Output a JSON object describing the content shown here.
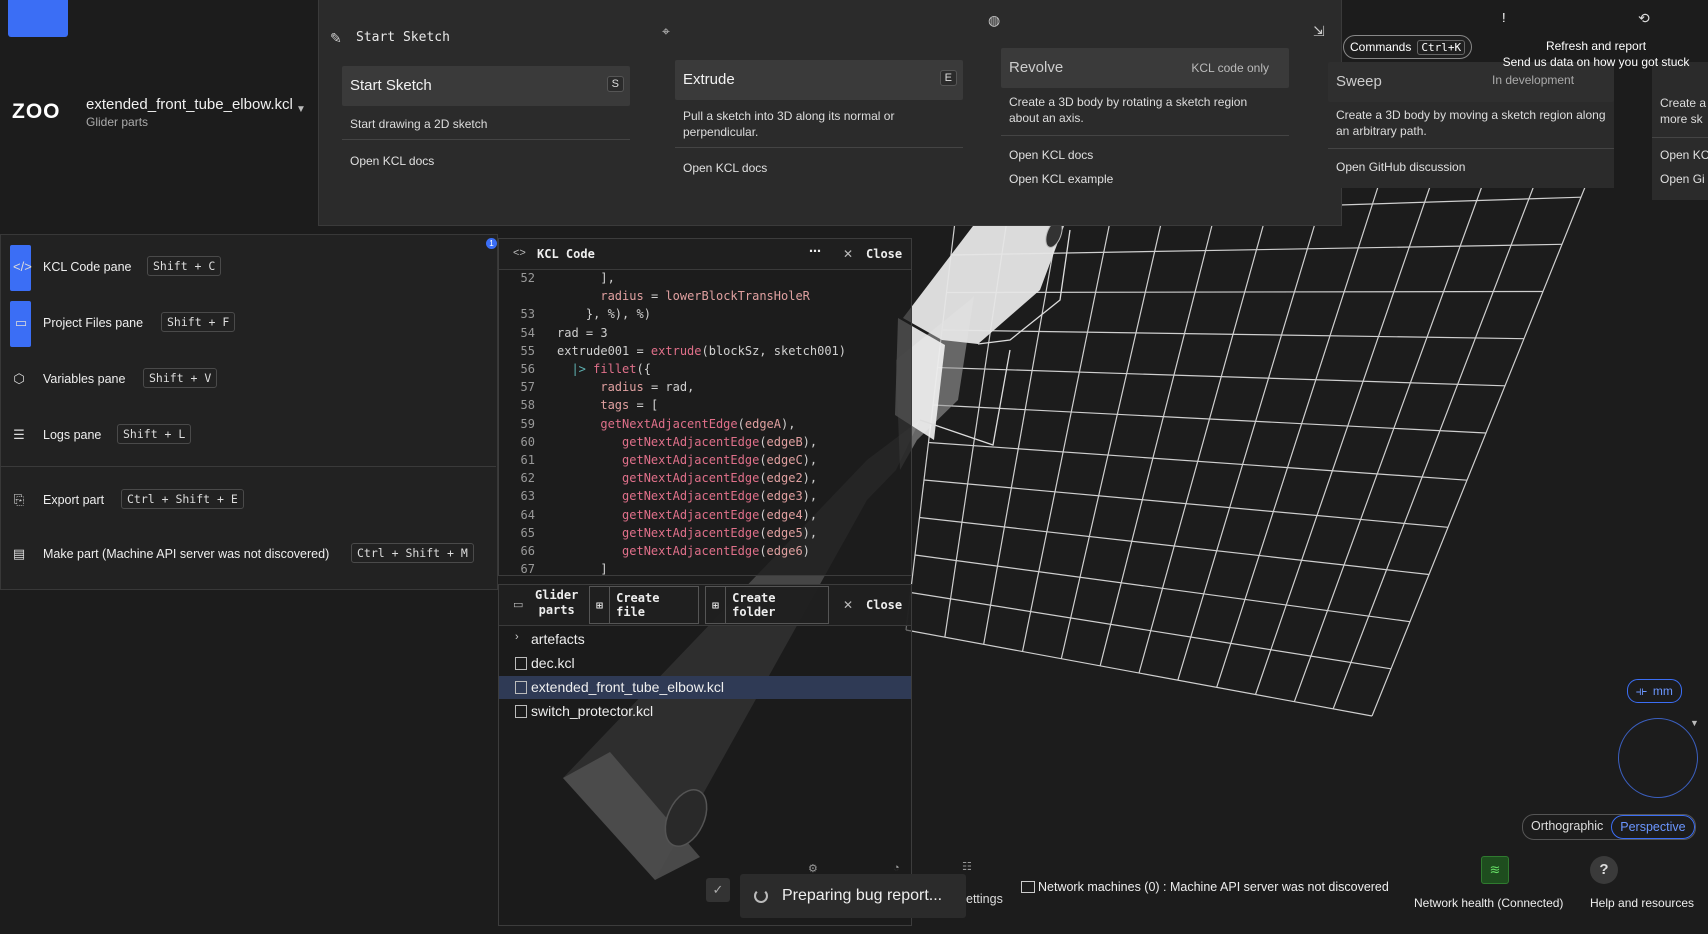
{
  "app": {
    "logo": "ZOO",
    "file_name": "extended_front_tube_elbow.kcl",
    "project_name": "Glider parts"
  },
  "toolbar": {
    "start_sketch_label": "Start Sketch",
    "cards": [
      {
        "title": "Start Sketch",
        "shortcut": "S",
        "description": "Start drawing a 2D sketch",
        "links": [
          "Open KCL docs"
        ]
      },
      {
        "title": "Extrude",
        "shortcut": "E",
        "description": "Pull a sketch into 3D along its normal or perpendicular.",
        "links": [
          "Open KCL docs"
        ]
      },
      {
        "title": "Revolve",
        "badge": "KCL code only",
        "description": "Create a 3D body by rotating a sketch region about an axis.",
        "links": [
          "Open KCL docs",
          "Open KCL example"
        ]
      },
      {
        "title": "Sweep",
        "badge": "In development",
        "description": "Create a 3D body by moving a sketch region along an arbitrary path.",
        "links": [
          "Open GitHub discussion"
        ]
      }
    ],
    "partial_card": {
      "description": "Create a more sk",
      "links": [
        "Open KC",
        "Open Gi"
      ]
    }
  },
  "header_right": {
    "commands_label": "Commands",
    "commands_shortcut": "Ctrl+K",
    "alert_label": "!",
    "tooltip_line1": "Refresh and report",
    "tooltip_line2": "Send us data on how you got stuck"
  },
  "pane_list": {
    "badge": "1",
    "items": [
      {
        "label": "KCL Code pane",
        "shortcut": "Shift + C",
        "icon": "code-icon",
        "active": true
      },
      {
        "label": "Project Files pane",
        "shortcut": "Shift + F",
        "icon": "folder-icon",
        "active": true
      },
      {
        "label": "Variables pane",
        "shortcut": "Shift + V",
        "icon": "variable-icon",
        "active": false
      },
      {
        "label": "Logs pane",
        "shortcut": "Shift + L",
        "icon": "list-icon",
        "active": false
      }
    ],
    "actions": [
      {
        "label": "Export part",
        "shortcut": "Ctrl + Shift + E",
        "icon": "export-icon"
      },
      {
        "label": "Make part (Machine API server was not discovered)",
        "shortcut": "Ctrl + Shift + M",
        "icon": "printer-icon"
      }
    ]
  },
  "code_pane": {
    "title": "KCL Code",
    "menu_label": "⋯",
    "close_label": "Close",
    "lines": [
      {
        "n": "52",
        "text": "      ],"
      },
      {
        "n": "",
        "text": "      radius = lowerBlockTransHoleR"
      },
      {
        "n": "53",
        "text": "    }, %), %)"
      },
      {
        "n": "54",
        "text": "rad = 3"
      },
      {
        "n": "55",
        "text": "extrude001 = extrude(blockSz, sketch001)"
      },
      {
        "n": "56",
        "text": "  |> fillet({"
      },
      {
        "n": "57",
        "text": "      radius = rad,"
      },
      {
        "n": "58",
        "text": "      tags = ["
      },
      {
        "n": "59",
        "text": "      getNextAdjacentEdge(edgeA),"
      },
      {
        "n": "60",
        "text": "         getNextAdjacentEdge(edgeB),"
      },
      {
        "n": "61",
        "text": "         getNextAdjacentEdge(edgeC),"
      },
      {
        "n": "62",
        "text": "         getNextAdjacentEdge(edge2),"
      },
      {
        "n": "63",
        "text": "         getNextAdjacentEdge(edge3),"
      },
      {
        "n": "64",
        "text": "         getNextAdjacentEdge(edge4),"
      },
      {
        "n": "65",
        "text": "         getNextAdjacentEdge(edge5),"
      },
      {
        "n": "66",
        "text": "         getNextAdjacentEdge(edge6)"
      },
      {
        "n": "67",
        "text": "      ]"
      }
    ]
  },
  "file_pane": {
    "title_line1": "Glider",
    "title_line2": "parts",
    "create_file_label": "Create file",
    "create_folder_label": "Create folder",
    "close_label": "Close",
    "items": [
      {
        "name": "artefacts",
        "type": "folder"
      },
      {
        "name": "dec.kcl",
        "type": "file"
      },
      {
        "name": "extended_front_tube_elbow.kcl",
        "type": "file",
        "selected": true
      },
      {
        "name": "switch_protector.kcl",
        "type": "file"
      }
    ]
  },
  "viewport": {
    "unit_label": "mm",
    "projection_options": [
      "Orthographic",
      "Perspective"
    ],
    "projection_selected": "Perspective"
  },
  "status_bar": {
    "network_machines": "Network machines (0) : Machine API server was not discovered",
    "network_health": "Network health (Connected)",
    "help_label": "Help and resources",
    "help_icon": "?",
    "settings_tail": "ettings"
  },
  "toast": {
    "text": "Preparing bug report..."
  },
  "colors": {
    "accent": "#3b6ef5",
    "background": "#1c1c1c",
    "panel": "#2b2b2b",
    "keyword": "#e0708a"
  }
}
